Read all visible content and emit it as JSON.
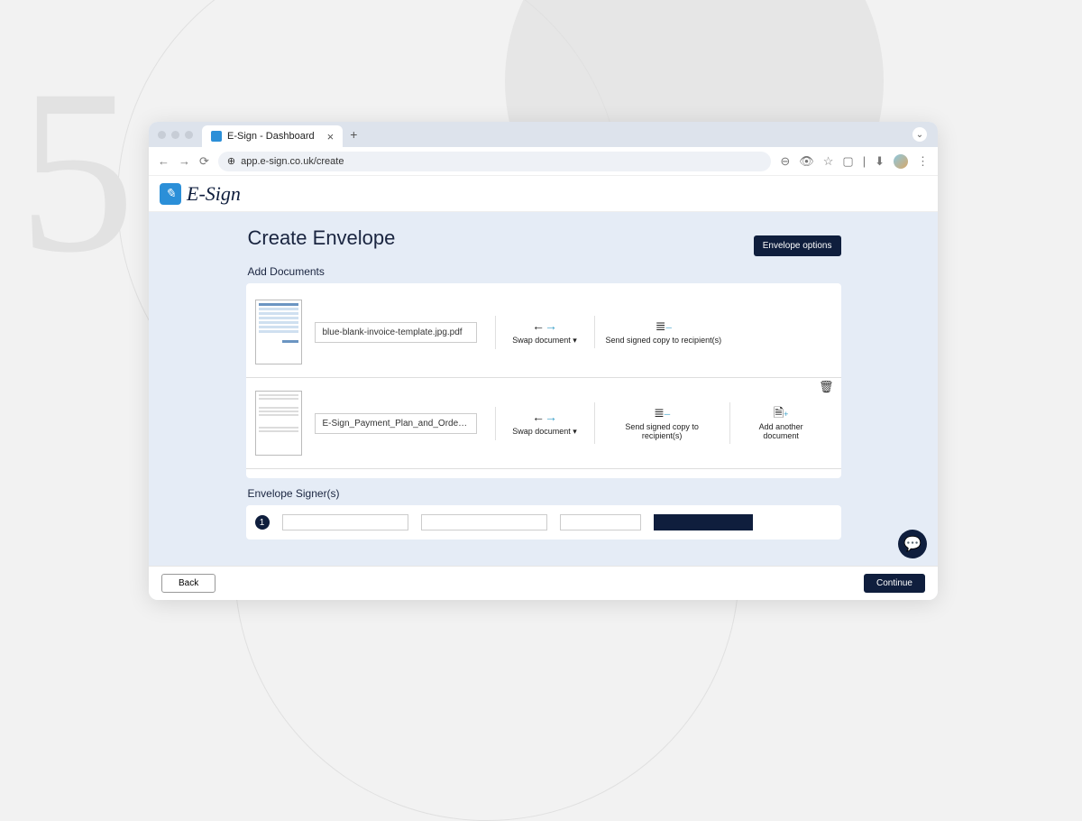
{
  "background": {
    "step_number": "5"
  },
  "tab": {
    "title": "E-Sign - Dashboard"
  },
  "url": "app.e-sign.co.uk/create",
  "brand": {
    "name": "E-Sign"
  },
  "page": {
    "title": "Create Envelope",
    "envelope_options_label": "Envelope options",
    "add_documents_label": "Add Documents",
    "signers_label": "Envelope Signer(s)"
  },
  "documents": [
    {
      "name": "blue-blank-invoice-template.jpg.pdf",
      "swap_label": "Swap document",
      "send_label": "Send signed copy to recipient(s)"
    },
    {
      "name": "E-Sign_Payment_Plan_and_Order_Form_l",
      "swap_label": "Swap document",
      "send_label": "Send signed copy to recipient(s)",
      "add_label": "Add another document"
    }
  ],
  "signers": {
    "index": "1"
  },
  "footer": {
    "back_label": "Back",
    "continue_label": "Continue"
  }
}
